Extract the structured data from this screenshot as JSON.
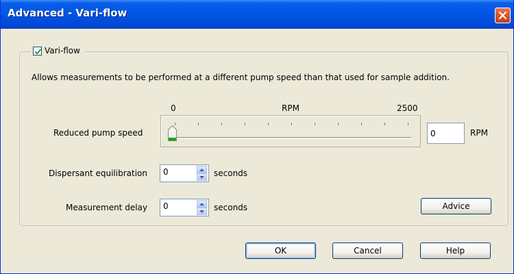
{
  "window": {
    "title": "Advanced - Vari-flow"
  },
  "group": {
    "checkbox_label": "Vari-flow",
    "checked": true,
    "description": "Allows measurements to be performed at a different pump speed than that used for sample addition."
  },
  "slider": {
    "label": "Reduced pump speed",
    "min_label": "0",
    "unit_label": "RPM",
    "max_label": "2500",
    "min": 0,
    "max": 2500,
    "value": 0,
    "input_value": "0",
    "input_unit": "RPM"
  },
  "dispersant": {
    "label": "Dispersant equilibration",
    "value": "0",
    "unit": "seconds"
  },
  "delay": {
    "label": "Measurement delay",
    "value": "0",
    "unit": "seconds"
  },
  "buttons": {
    "advice": "Advice",
    "ok": "OK",
    "cancel": "Cancel",
    "help": "Help"
  },
  "colors": {
    "title_bar": "#0055e5",
    "dialog_bg": "#ece9d8",
    "close_button": "#d8542e",
    "check_mark": "#21a121",
    "slider_thumb_accent": "#21a121"
  },
  "icons": {
    "close": "close-x-icon",
    "check": "check-mark-icon",
    "thumb": "slider-thumb-icon",
    "spin_up": "spin-up-arrow-icon",
    "spin_down": "spin-down-arrow-icon"
  }
}
